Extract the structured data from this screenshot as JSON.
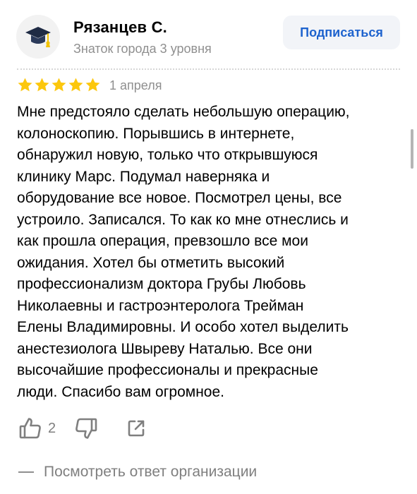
{
  "author": {
    "name": "Рязанцев С.",
    "level": "Знаток города 3 уровня",
    "avatar_icon": "graduation-cap-icon"
  },
  "subscribe_label": "Подписаться",
  "review": {
    "rating": 5,
    "rating_max": 5,
    "date": "1 апреля",
    "text": "Мне предстояло сделать небольшую операцию,\nколоноскопию. Порывшись в интернете,\nобнаружил новую, только что открывшуюся\nклинику Марс. Подумал наверняка и\nоборудование все новое. Посмотрел цены, все\nустроило. Записался. То как ко мне отнеслись и\nкак прошла операция, превзошло все мои\nожидания. Хотел бы отметить высокий\nпрофессионализм доктора Грубы Любовь\nНиколаевны и гастроэнтеролога Трейман\nЕлены Владимировны. И особо хотел выделить\nанестезиолога Швыреву Наталью. Все они\nвысочайшие профессионалы и прекрасные\nлюди. Спасибо вам огромное."
  },
  "actions": {
    "like_count": "2",
    "like_icon": "thumbs-up-icon",
    "dislike_icon": "thumbs-down-icon",
    "share_icon": "share-icon"
  },
  "org_reply_label": "Посмотреть ответ организации",
  "colors": {
    "star": "#fcc70d",
    "accent": "#1e63ce",
    "muted": "#8f8f8f"
  }
}
